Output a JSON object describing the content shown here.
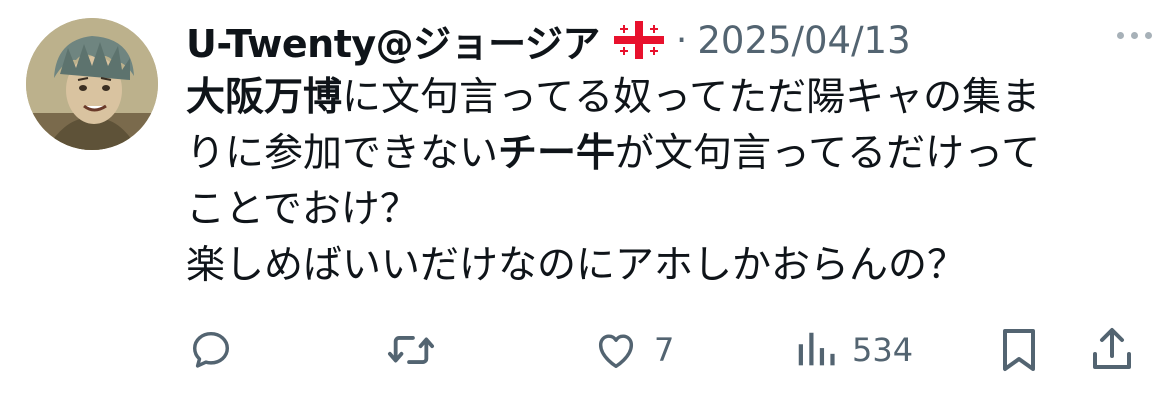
{
  "tweet": {
    "author": {
      "display_name": "U-Twenty@ジョージア",
      "flag_icon": "georgia-flag-icon"
    },
    "separator": "·",
    "date": "2025/04/13",
    "text": {
      "line1_bold": "大阪万博",
      "line1_rest": "に文句言ってる奴ってただ陽キャの集ま",
      "line2_start": "りに参加できない",
      "line2_bold": "チー牛",
      "line2_rest": "が文句言ってるだけって",
      "line3": "ことでおけ？",
      "line4": "楽しめばいいだけなのにアホしかおらんの？"
    },
    "actions": {
      "reply_icon": "reply-icon",
      "retweet_icon": "retweet-icon",
      "like_icon": "heart-icon",
      "like_count": "7",
      "views_icon": "views-icon",
      "views_count": "534",
      "bookmark_icon": "bookmark-icon",
      "share_icon": "share-icon"
    },
    "colors": {
      "text_primary": "#0f1419",
      "text_secondary": "#536471",
      "flag_red": "#e8112d"
    }
  }
}
